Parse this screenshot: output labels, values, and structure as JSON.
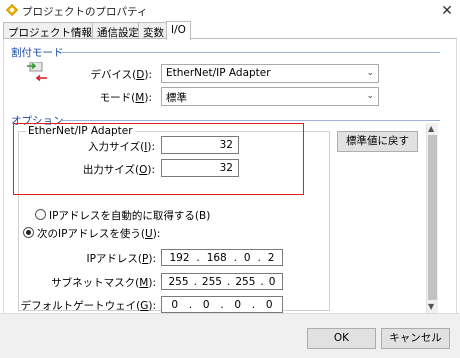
{
  "window": {
    "title": "プロジェクトのプロパティ",
    "close_glyph": "✕"
  },
  "tabs": [
    {
      "label": "プロジェクト情報",
      "active": false
    },
    {
      "label": "通信設定",
      "active": false
    },
    {
      "label": "変数",
      "active": false
    },
    {
      "label": "I/O",
      "active": true
    }
  ],
  "assign_mode": {
    "section_label": "割付モード",
    "device": {
      "label": "デバイス(",
      "key": "D",
      "suffix": "):",
      "value": "EtherNet/IP Adapter"
    },
    "mode": {
      "label": "モード(",
      "key": "M",
      "suffix": "):",
      "value": "標準"
    }
  },
  "options": {
    "section_label": "オプション",
    "group_title": "EtherNet/IP Adapter",
    "input_size": {
      "label": "入力サイズ(",
      "key": "I",
      "suffix": "):",
      "value": "32"
    },
    "output_size": {
      "label": "出力サイズ(",
      "key": "O",
      "suffix": "):",
      "value": "32"
    },
    "reset_button": "標準値に戻す",
    "radio_auto": {
      "label": "IPアドレスを自動的に取得する(B)",
      "selected": false
    },
    "radio_manual": {
      "label": "次のIPアドレスを使う(",
      "key": "U",
      "suffix": "):",
      "selected": true
    },
    "ip_address": {
      "label": "IPアドレス(",
      "key": "P",
      "suffix": "):",
      "octets": [
        "192",
        "168",
        "0",
        "2"
      ]
    },
    "subnet": {
      "label": "サブネットマスク(",
      "key": "M",
      "suffix": "):",
      "octets": [
        "255",
        "255",
        "255",
        "0"
      ]
    },
    "gateway": {
      "label": "デフォルトゲートウェイ(",
      "key": "G",
      "suffix": "):",
      "octets": [
        "0",
        "0",
        "0",
        "0"
      ]
    }
  },
  "footer": {
    "ok": "OK",
    "cancel": "キャンセル"
  },
  "colors": {
    "section": "#1a4aa8",
    "highlight_box": "#e02020"
  }
}
